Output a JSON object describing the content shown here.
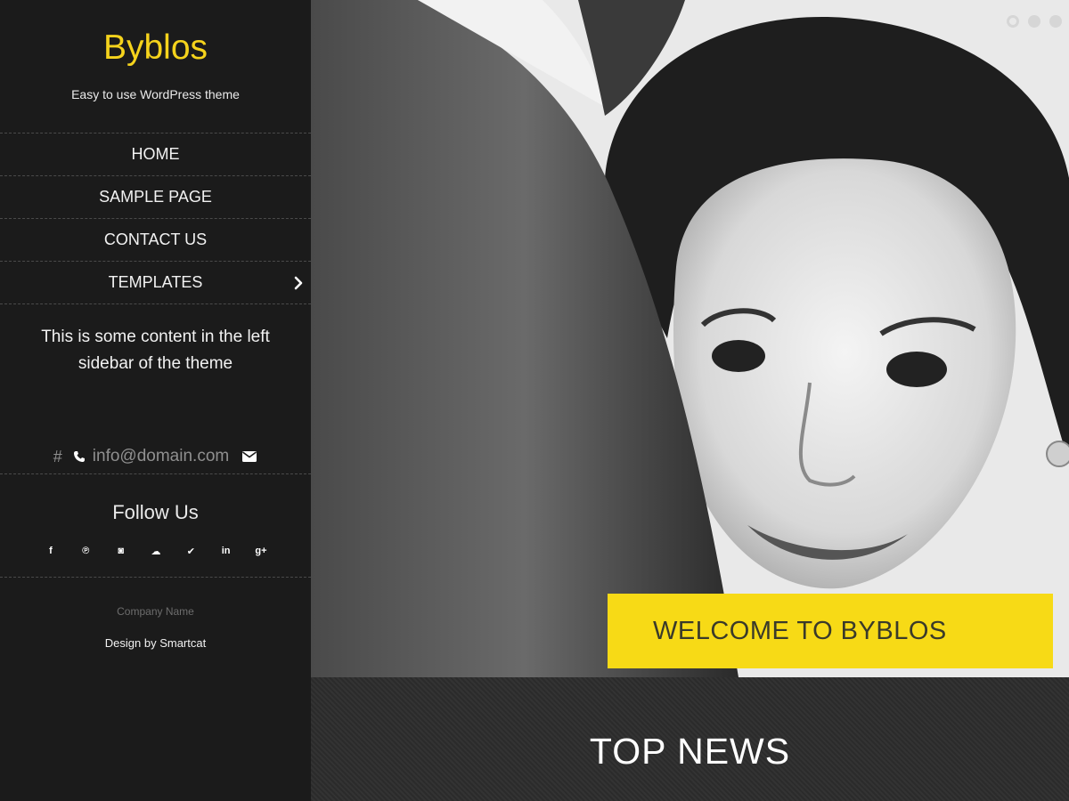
{
  "site": {
    "title": "Byblos",
    "tagline": "Easy to use WordPress theme"
  },
  "menu": {
    "items": [
      {
        "label": "HOME"
      },
      {
        "label": "SAMPLE PAGE"
      },
      {
        "label": "CONTACT US"
      },
      {
        "label": "TEMPLATES",
        "has_submenu": true
      }
    ]
  },
  "sidebar": {
    "text": "This is some content in the left sidebar of the theme",
    "contact": {
      "hash": "#",
      "email": "info@domain.com",
      "icons": [
        "phone-icon",
        "envelope-icon"
      ]
    },
    "follow_title": "Follow Us",
    "social_icons": [
      {
        "name": "facebook-icon",
        "glyph": "f"
      },
      {
        "name": "pinterest-icon",
        "glyph": "℗"
      },
      {
        "name": "instagram-icon",
        "glyph": "◙"
      },
      {
        "name": "soundcloud-icon",
        "glyph": "☁"
      },
      {
        "name": "twitter-icon",
        "glyph": "✔"
      },
      {
        "name": "linkedin-icon",
        "glyph": "in"
      },
      {
        "name": "google-plus-icon",
        "glyph": "g+"
      }
    ],
    "company": "Company Name",
    "credit": "Design by Smartcat"
  },
  "hero": {
    "slide_count": 3,
    "active_slide": 1,
    "welcome_text": "WELCOME TO BYBLOS"
  },
  "section": {
    "title": "TOP NEWS"
  },
  "colors": {
    "accent": "#f7da16",
    "sidebar_bg": "#1b1b1b"
  }
}
